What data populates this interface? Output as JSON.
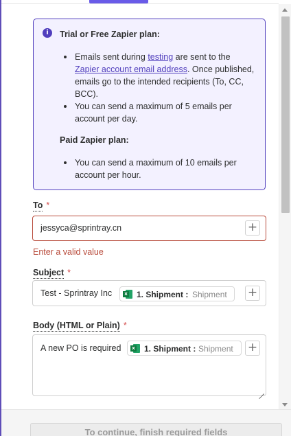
{
  "info": {
    "trial_heading": "Trial or Free Zapier plan:",
    "trial_item1_prefix": "Emails sent during ",
    "trial_item1_link1": "testing",
    "trial_item1_mid": " are sent to the ",
    "trial_item1_link2": "Zapier account email address",
    "trial_item1_suffix": ". Once published, emails go to the intended recipients (To, CC, BCC).",
    "trial_item2": "You can send a maximum of 5 emails per account per day.",
    "paid_heading": "Paid Zapier plan:",
    "paid_item1": "You can send a maximum of 10 emails per account per hour."
  },
  "to": {
    "label": "To",
    "required_mark": "*",
    "value": "jessyca@sprintray.cn",
    "error": "Enter a valid value"
  },
  "subject": {
    "label": "Subject",
    "required_mark": "*",
    "text": "Test - Sprintray Inc",
    "pill_step": "1. Shipment :",
    "pill_value": "Shipment"
  },
  "body": {
    "label": "Body (HTML or Plain)",
    "required_mark": "*",
    "text": "A new PO is required",
    "pill_step": "1. Shipment :",
    "pill_value": "Shipment"
  },
  "plus_symbol": "+",
  "footer": {
    "button_label": "To continue, finish required fields"
  },
  "colors": {
    "accent": "#503ebd",
    "error": "#b84a3a",
    "excel_green": "#107c41"
  }
}
